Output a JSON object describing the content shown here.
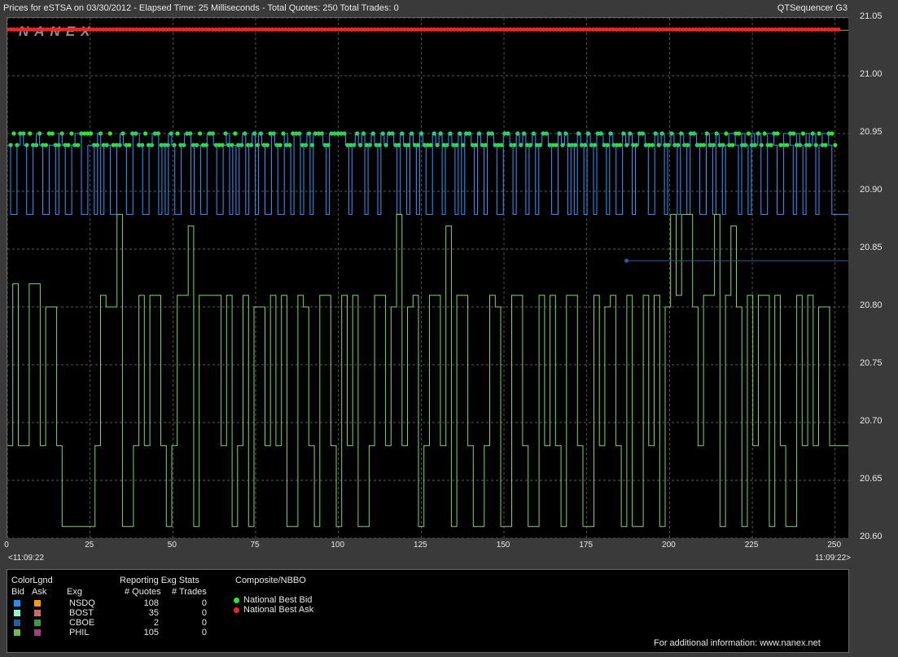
{
  "header": {
    "title": "Prices for  eSTSA  on  03/30/2012  -  Elapsed Time: 25 Milliseconds  -  Total Quotes: 250  Total Trades: 0",
    "app_name": "QTSequencer G3",
    "watermark": "NANEX"
  },
  "axes": {
    "y_ticks": [
      "21.05",
      "21.00",
      "20.95",
      "20.90",
      "20.85",
      "20.80",
      "20.75",
      "20.70",
      "20.65",
      "20.60"
    ],
    "x_ticks": [
      "0",
      "25",
      "50",
      "75",
      "100",
      "125",
      "150",
      "175",
      "200",
      "225",
      "250"
    ],
    "time_start": "<11:09:22",
    "time_end": "11:09:22>"
  },
  "legend": {
    "color_legend_title": "ColorLgnd",
    "bid_label": "Bid",
    "ask_label": "Ask",
    "stats_title": "Reporting Exg Stats",
    "exg_header": "Exg",
    "quotes_header": "# Quotes",
    "trades_header": "# Trades",
    "composite_title": "Composite/NBBO",
    "nbb_label": "National Best Bid",
    "nba_label": "National Best Ask",
    "footer": "For additional information: www.nanex.net",
    "exchanges": [
      {
        "name": "NSDQ",
        "quotes": "108",
        "trades": "0",
        "bid_color": "#1e90ff",
        "ask_color": "#ff9900"
      },
      {
        "name": "BOST",
        "quotes": "35",
        "trades": "0",
        "bid_color": "#7fffd4",
        "ask_color": "#cd6b6b"
      },
      {
        "name": "CBOE",
        "quotes": "2",
        "trades": "0",
        "bid_color": "#1f5fa8",
        "ask_color": "#3c9a3c"
      },
      {
        "name": "PHIL",
        "quotes": "105",
        "trades": "0",
        "bid_color": "#6fbf4a",
        "ask_color": "#a0407a"
      }
    ]
  },
  "chart_data": {
    "type": "line",
    "title": "Prices for  eSTSA  on  03/30/2012  -  Elapsed Time: 25 Milliseconds  -  Total Quotes: 250  Total Trades: 0",
    "xlim": [
      0,
      254
    ],
    "ylim": [
      20.6,
      21.05
    ],
    "grid": true,
    "series": [
      {
        "name": "National Best Ask",
        "color": "#ff2020",
        "kind": "dots",
        "constant": 21.04,
        "x_start": 0,
        "x_end": 251
      },
      {
        "name": "National Best Bid",
        "color": "#22ee22",
        "kind": "dots",
        "values": [
          20.94,
          20.95,
          20.94,
          20.95,
          20.95,
          20.94,
          20.95,
          20.94,
          20.94,
          20.95,
          20.94,
          20.94,
          20.95,
          20.95,
          20.94,
          20.94,
          20.95,
          20.94,
          20.94,
          20.95,
          20.94,
          20.94,
          20.95,
          20.95,
          20.95,
          20.95,
          20.94,
          20.94,
          20.95,
          20.94,
          20.94,
          20.95,
          20.94,
          20.94,
          20.94,
          20.95,
          20.94,
          20.94,
          20.95,
          20.95,
          20.94,
          20.94,
          20.95,
          20.94,
          20.94,
          20.95,
          20.95,
          20.94,
          20.94,
          20.94,
          20.95,
          20.94,
          20.95,
          20.94,
          20.94,
          20.95,
          20.95,
          20.94,
          20.94,
          20.95,
          20.94,
          20.94,
          20.95,
          20.95,
          20.94,
          20.94,
          20.94,
          20.95,
          20.94,
          20.94,
          20.95,
          20.94,
          20.94,
          20.95,
          20.94,
          20.94,
          20.95,
          20.94,
          20.95,
          20.94,
          20.94,
          20.95,
          20.95,
          20.94,
          20.94,
          20.95,
          20.94,
          20.94,
          20.95,
          20.95,
          20.95,
          20.94,
          20.94,
          20.95,
          20.94,
          20.95,
          20.95,
          20.95,
          20.94,
          20.94,
          20.95,
          20.95,
          20.95,
          20.95,
          20.95,
          20.94,
          20.94,
          20.94,
          20.95,
          20.94,
          20.95,
          20.94,
          20.94,
          20.95,
          20.94,
          20.94,
          20.95,
          20.94,
          20.95,
          20.95,
          20.94,
          20.94,
          20.95,
          20.94,
          20.94,
          20.95,
          20.94,
          20.94,
          20.95,
          20.94,
          20.94,
          20.94,
          20.95,
          20.94,
          20.95,
          20.94,
          20.94,
          20.95,
          20.94,
          20.94,
          20.95,
          20.94,
          20.95,
          20.95,
          20.94,
          20.94,
          20.95,
          20.94,
          20.94,
          20.95,
          20.95,
          20.94,
          20.94,
          20.94,
          20.95,
          20.95,
          20.94,
          20.94,
          20.95,
          20.94,
          20.95,
          20.94,
          20.94,
          20.95,
          20.94,
          20.94,
          20.95,
          20.95,
          20.94,
          20.94,
          20.94,
          20.95,
          20.94,
          20.95,
          20.94,
          20.94,
          20.94,
          20.95,
          20.94,
          20.94,
          20.95,
          20.94,
          20.94,
          20.95,
          20.95,
          20.94,
          20.94,
          20.95,
          20.94,
          20.94,
          20.94,
          20.95,
          20.94,
          20.95,
          20.94,
          20.94,
          20.95,
          20.95,
          20.94,
          20.94,
          20.94,
          20.95,
          20.94,
          20.95,
          20.94,
          20.94,
          20.95,
          20.94,
          20.94,
          20.95,
          20.94,
          20.94,
          20.95,
          20.95,
          20.94,
          20.94,
          20.94,
          20.95,
          20.94,
          20.94,
          20.95,
          20.94,
          20.94,
          20.95,
          20.94,
          20.94,
          20.95,
          20.95,
          20.94,
          20.94,
          20.95,
          20.94,
          20.94,
          20.95,
          20.94,
          20.95,
          20.94,
          20.94,
          20.95,
          20.95,
          20.94,
          20.94,
          20.94,
          20.95,
          20.95,
          20.94,
          20.94,
          20.95,
          20.94,
          20.94,
          20.95,
          20.94,
          20.95,
          20.94,
          20.94,
          20.95,
          20.95,
          20.94
        ]
      },
      {
        "name": "NSDQ",
        "color": "#3399ff",
        "kind": "step",
        "values": [
          20.94,
          20.88,
          20.88,
          20.94,
          20.95,
          20.94,
          20.88,
          20.88,
          20.94,
          20.95,
          20.94,
          20.88,
          20.88,
          20.94,
          20.94,
          20.88,
          20.95,
          20.94,
          20.88,
          20.88,
          20.94,
          20.95,
          20.95,
          20.88,
          20.88,
          20.94,
          20.94,
          20.88,
          20.95,
          20.88,
          20.94,
          20.94,
          20.88,
          20.88,
          20.94,
          20.95,
          20.94,
          20.88,
          20.88,
          20.95,
          20.95,
          20.94,
          20.88,
          20.88,
          20.94,
          20.95,
          20.95,
          20.88,
          20.94,
          20.88,
          20.95,
          20.94,
          20.88,
          20.88,
          20.94,
          20.95,
          20.95,
          20.88,
          20.94,
          20.94,
          20.88,
          20.88,
          20.95,
          20.95,
          20.94,
          20.88,
          20.88,
          20.94,
          20.95,
          20.88,
          20.94,
          20.88,
          20.94,
          20.95,
          20.88,
          20.94,
          20.95,
          20.88,
          20.95,
          20.94,
          20.88,
          20.88,
          20.95,
          20.94,
          20.88,
          20.88,
          20.95,
          20.94,
          20.88,
          20.95,
          20.95,
          20.88,
          20.94,
          20.95,
          20.88,
          20.95,
          20.95,
          20.95,
          20.94,
          20.88,
          20.95,
          20.95,
          20.95,
          20.95,
          20.95,
          20.94,
          20.88,
          20.94,
          20.95,
          20.94,
          20.95,
          20.88,
          20.94,
          20.95,
          20.94,
          20.88,
          20.95,
          20.94,
          20.95,
          20.95,
          20.94,
          20.88,
          20.95,
          20.94,
          20.88,
          20.95,
          20.94,
          20.88,
          20.95,
          20.94,
          20.88,
          20.88,
          20.95,
          20.94,
          20.95,
          20.88,
          20.94,
          20.95,
          20.94,
          20.88,
          20.95,
          20.88,
          20.95,
          20.95,
          20.94,
          20.88,
          20.95,
          20.94,
          20.88,
          20.95,
          20.95,
          20.94,
          20.88,
          20.88,
          20.95,
          20.95,
          20.94,
          20.88,
          20.95,
          20.94,
          20.95,
          20.88,
          20.94,
          20.95,
          20.88,
          20.94,
          20.95,
          20.95,
          20.94,
          20.88,
          20.88,
          20.95,
          20.94,
          20.95,
          20.88,
          20.94,
          20.88,
          20.95,
          20.94,
          20.88,
          20.95,
          20.94,
          20.88,
          20.95,
          20.95,
          20.94,
          20.88,
          20.95,
          20.94,
          20.88,
          20.88,
          20.95,
          20.94,
          20.95,
          20.88,
          20.94,
          20.95,
          20.95,
          20.94,
          20.88,
          20.88,
          20.95,
          20.94,
          20.95,
          20.88,
          20.94,
          20.95,
          20.94,
          20.88,
          20.95,
          20.94,
          20.88,
          20.95,
          20.95,
          20.94,
          20.88,
          20.88,
          20.95,
          20.94,
          20.88,
          20.95,
          20.94,
          20.88,
          20.94,
          20.95,
          20.95,
          20.94,
          20.88,
          20.95,
          20.94,
          20.88,
          20.95,
          20.94,
          20.95,
          20.88,
          20.88,
          20.95,
          20.95,
          20.94,
          20.88,
          20.88,
          20.95,
          20.95,
          20.94,
          20.88,
          20.95,
          20.94,
          20.88,
          20.95,
          20.94,
          20.95,
          20.88,
          20.94,
          20.95,
          20.95,
          20.94,
          20.88
        ]
      },
      {
        "name": "PHIL",
        "color": "#7fd46a",
        "kind": "step",
        "values": [
          20.68,
          20.82,
          20.68,
          20.68,
          20.82,
          20.82,
          20.68,
          20.8,
          20.8,
          20.68,
          20.61,
          20.61,
          20.61,
          20.61,
          20.61,
          20.61,
          20.68,
          20.81,
          20.8,
          20.8,
          20.88,
          20.61,
          20.61,
          20.68,
          20.81,
          20.68,
          20.81,
          20.81,
          20.68,
          20.61,
          20.68,
          20.81,
          20.81,
          20.87,
          20.61,
          20.81,
          20.81,
          20.81,
          20.81,
          20.68,
          20.81,
          20.61,
          20.68,
          20.81,
          20.61,
          20.8,
          20.8,
          20.68,
          20.81,
          20.68,
          20.81,
          20.61,
          20.61,
          20.81,
          20.8,
          20.68,
          20.61,
          20.81,
          20.81,
          20.68,
          20.61,
          20.81,
          20.68,
          20.81,
          20.61,
          20.61,
          20.68,
          20.81,
          20.81,
          20.68,
          20.8,
          20.88,
          20.68,
          20.8,
          20.81,
          20.61,
          20.68,
          20.81,
          20.81,
          20.68,
          20.87,
          20.61,
          20.81,
          20.81,
          20.68,
          20.61,
          20.61,
          20.68,
          20.81,
          20.8,
          20.61,
          20.61,
          20.81,
          20.81,
          20.68,
          20.61,
          20.61,
          20.81,
          20.68,
          20.81,
          20.68,
          20.61,
          20.81,
          20.81,
          20.68,
          20.61,
          20.61,
          20.81,
          20.68,
          20.8,
          20.81,
          20.68,
          20.61,
          20.81,
          20.61,
          20.61,
          20.81,
          20.68,
          20.81,
          20.61,
          20.8,
          20.88,
          20.81,
          20.88,
          20.88,
          20.8,
          20.68,
          20.81,
          20.81,
          20.88,
          20.61,
          20.81,
          20.87,
          20.8,
          20.61,
          20.81,
          20.68,
          20.81,
          20.81,
          20.61,
          20.81,
          20.68,
          20.61,
          20.61,
          20.81,
          20.68,
          20.81,
          20.68,
          20.8,
          20.8,
          20.68
        ]
      },
      {
        "name": "CBOE",
        "color": "#1f5fa8",
        "kind": "point",
        "x": [
          187
        ],
        "values": [
          20.84
        ]
      }
    ]
  }
}
